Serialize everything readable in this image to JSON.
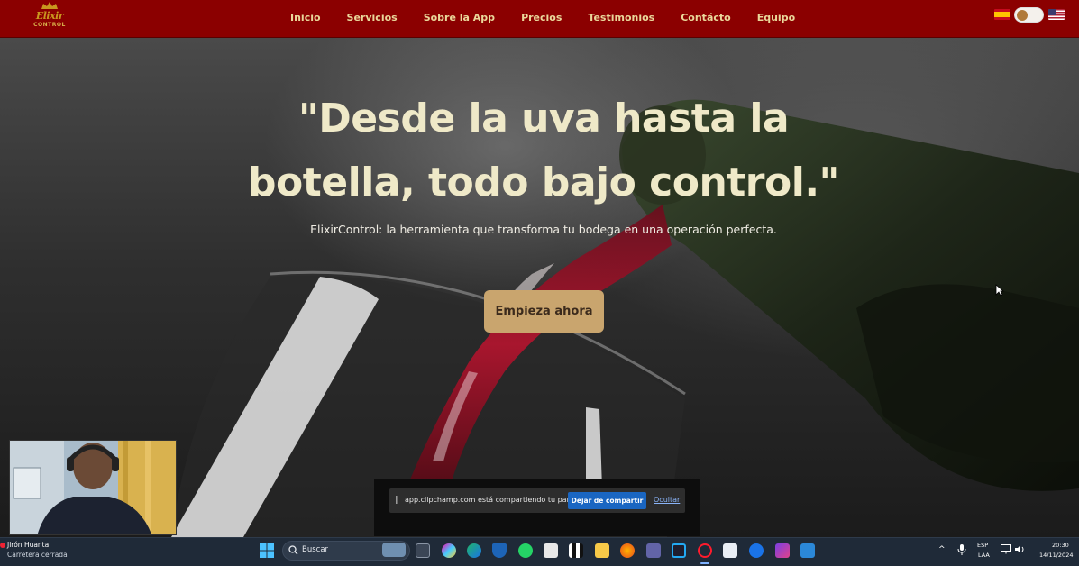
{
  "nav": {
    "logo_text": "Elixir",
    "logo_sub": "CONTROL",
    "links": [
      "Inicio",
      "Servicios",
      "Sobre la App",
      "Precios",
      "Testimonios",
      "Contácto",
      "Equipo"
    ]
  },
  "hero": {
    "headline_line1": "\"Desde la uva hasta la",
    "headline_line2": "botella, todo bajo control.\"",
    "subtitle": "ElixirControl: la herramienta que transforma tu bodega en una operación perfecta.",
    "cta_label": "Empieza ahora"
  },
  "share_bar": {
    "message": "app.clipchamp.com está compartiendo tu pantalla.",
    "stop_label": "Dejar de compartir",
    "hide_label": "Ocultar"
  },
  "taskbar": {
    "weather_title": "Jirón Huanta",
    "weather_sub": "Carretera cerrada",
    "search_placeholder": "Buscar",
    "lang_line1": "ESP",
    "lang_line2": "LAA",
    "time": "20:30",
    "date": "14/11/2024"
  },
  "colors": {
    "nav_bg": "#8b0000",
    "nav_link": "#ead79a",
    "headline": "#efe9c8",
    "cta_bg": "#c9a56e",
    "share_button": "#1a66c2",
    "taskbar_bg": "#1f2a38"
  }
}
